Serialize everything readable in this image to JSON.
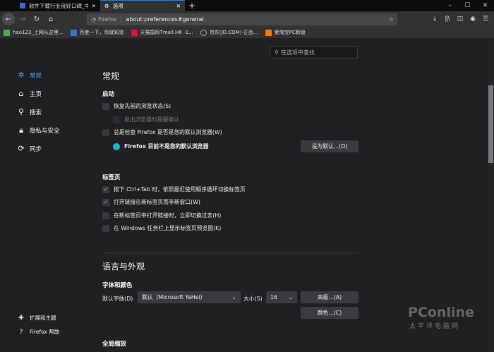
{
  "tabs": [
    {
      "title": "软件下载行业良好口碑_中国最"
    },
    {
      "title": "选项"
    }
  ],
  "window_controls": {
    "minimize": "–",
    "maximize": "☐",
    "close": "✕"
  },
  "url_bar": {
    "identity": "Firefox",
    "address": "about:preferences#general"
  },
  "bookmarks": [
    {
      "label": "hao123_上网从这里...",
      "color": "#4caf50"
    },
    {
      "label": "百度一下，你就知道",
      "color": "#3a6fd8"
    },
    {
      "label": "天猫国际Tmall.HK -1...",
      "color": "#e0102f"
    },
    {
      "label": "京东(JD.COM)-正品...",
      "color": "#888888"
    },
    {
      "label": "爱淘宝PC新版",
      "color": "#ff7a00"
    }
  ],
  "sidebar": {
    "items": [
      {
        "label": "常规",
        "icon": "gear-icon"
      },
      {
        "label": "主页",
        "icon": "home-icon"
      },
      {
        "label": "搜索",
        "icon": "search-icon"
      },
      {
        "label": "隐私与安全",
        "icon": "lock-icon"
      },
      {
        "label": "同步",
        "icon": "sync-icon"
      }
    ],
    "footer": [
      {
        "label": "扩展和主题",
        "icon": "puzzle-icon"
      },
      {
        "label": "Firefox 帮助",
        "icon": "help-icon"
      }
    ]
  },
  "search": {
    "placeholder": "在选项中查找"
  },
  "general": {
    "title": "常规",
    "startup": {
      "heading": "启动",
      "restore": "恢复先前的浏览状态(S)",
      "warn_quit": "退出浏览器时提醒确认",
      "check_default": "总是检查 Firefox 是否是您的默认浏览器(W)",
      "not_default": "Firefox 目前不是您的默认浏览器",
      "set_default": "设为默认...(D)"
    },
    "tabs": {
      "heading": "标签页",
      "items": [
        {
          "label": "按下 Ctrl+Tab 时，依照最近使用顺序循环切换标签页",
          "checked": true
        },
        {
          "label": "打开链接在新标签页而非新窗口(W)",
          "checked": true
        },
        {
          "label": "在新标签页中打开链接时，立即切换过去(H)",
          "checked": false
        },
        {
          "label": "在 Windows 任务栏上显示标签页预览图(K)",
          "checked": false
        }
      ]
    }
  },
  "language": {
    "title": "语言与外观",
    "fonts_heading": "字体和颜色",
    "default_font_label": "默认字体(D)",
    "default_font_value": "默认（Microsoft YaHei）",
    "size_label": "大小(S)",
    "size_value": "16",
    "advanced": "高级...(A)",
    "colors": "颜色...(C)",
    "zoom_heading": "全局缩放"
  },
  "watermark": {
    "brand": "PConline",
    "sub": "太平洋电脑网"
  },
  "accent": "#0a84ff"
}
